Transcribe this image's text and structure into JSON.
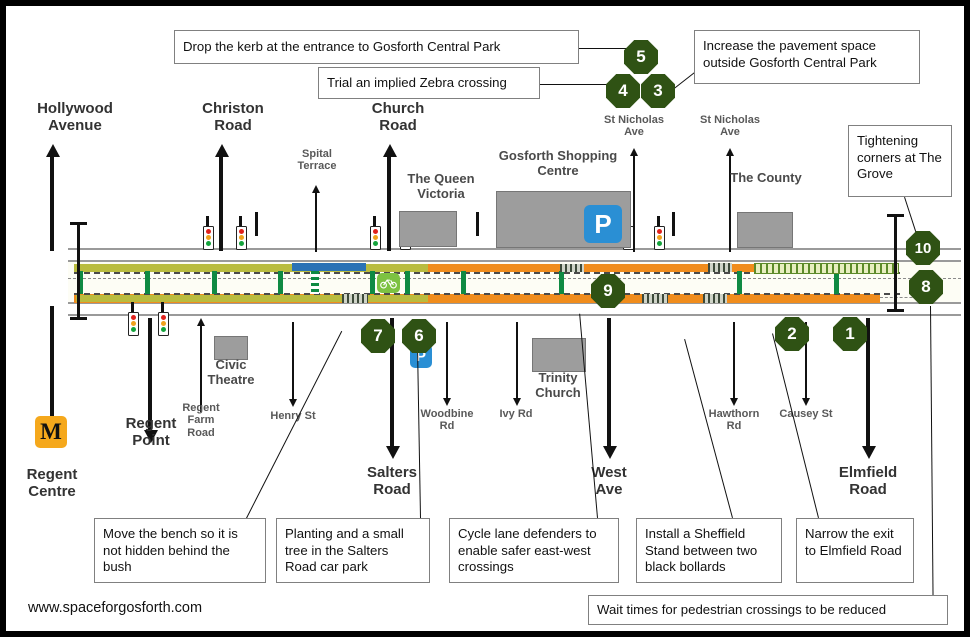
{
  "page": {
    "website": "www.spaceforgosforth.com",
    "accent_green": "#2f5214",
    "orange": "#f08c1c",
    "olive": "#b9bc3f",
    "defender_green": "#0f8a43",
    "metro_amber": "#f5a81c",
    "parking_blue": "#2a8fd4"
  },
  "callouts": [
    {
      "id": "c5",
      "text": "Drop the kerb at the entrance to Gosforth Central Park"
    },
    {
      "id": "c4",
      "text": "Trial an implied Zebra crossing"
    },
    {
      "id": "c3",
      "text": "Increase the pavement space outside Gosforth Central Park"
    },
    {
      "id": "c10",
      "text": "Tightening corners at The Grove"
    },
    {
      "id": "c7",
      "text": "Move the bench so it is not hidden behind the bush"
    },
    {
      "id": "c6",
      "text": "Planting and a small tree in the Salters Road car park"
    },
    {
      "id": "c9",
      "text": "Cycle lane defenders to enable safer east-west crossings"
    },
    {
      "id": "c2",
      "text": "Install a Sheffield Stand between two black bollards"
    },
    {
      "id": "c1",
      "text": "Narrow the exit to Elmfield Road"
    },
    {
      "id": "c8",
      "text": "Wait times for pedestrian crossings to be reduced"
    }
  ],
  "badges": [
    {
      "n": "1"
    },
    {
      "n": "2"
    },
    {
      "n": "3"
    },
    {
      "n": "4"
    },
    {
      "n": "5"
    },
    {
      "n": "6"
    },
    {
      "n": "7"
    },
    {
      "n": "8"
    },
    {
      "n": "9"
    },
    {
      "n": "10"
    }
  ],
  "streets_top": [
    {
      "id": "hollywood",
      "name": "Hollywood Avenue"
    },
    {
      "id": "christon",
      "name": "Christon Road"
    },
    {
      "id": "spital",
      "name": "Spital Terrace"
    },
    {
      "id": "church",
      "name": "Church Road"
    },
    {
      "id": "stnich_w",
      "name": "St Nicholas Ave"
    },
    {
      "id": "stnich_e",
      "name": "St Nicholas Ave"
    }
  ],
  "streets_bottom": [
    {
      "id": "regent_centre",
      "name": "Regent Centre"
    },
    {
      "id": "regent_point",
      "name": "Regent Point"
    },
    {
      "id": "regent_farm",
      "name": "Regent Farm Road"
    },
    {
      "id": "henry_st",
      "name": "Henry St"
    },
    {
      "id": "salters",
      "name": "Salters Road"
    },
    {
      "id": "woodbine",
      "name": "Woodbine Rd"
    },
    {
      "id": "ivy",
      "name": "Ivy Rd"
    },
    {
      "id": "west_ave",
      "name": "West Ave"
    },
    {
      "id": "hawthorn",
      "name": "Hawthorn Rd"
    },
    {
      "id": "causey",
      "name": "Causey St"
    },
    {
      "id": "elmfield",
      "name": "Elmfield Road"
    }
  ],
  "landmarks": [
    {
      "id": "queen_victoria",
      "name": "The Queen Victoria"
    },
    {
      "id": "shopping_centre",
      "name": "Gosforth Shopping Centre"
    },
    {
      "id": "the_county",
      "name": "The County"
    },
    {
      "id": "civic_theatre",
      "name": "Civic Theatre"
    },
    {
      "id": "trinity_church",
      "name": "Trinity Church"
    }
  ],
  "icons": {
    "metro": "M",
    "parking": "P",
    "bike": "bicycle"
  }
}
